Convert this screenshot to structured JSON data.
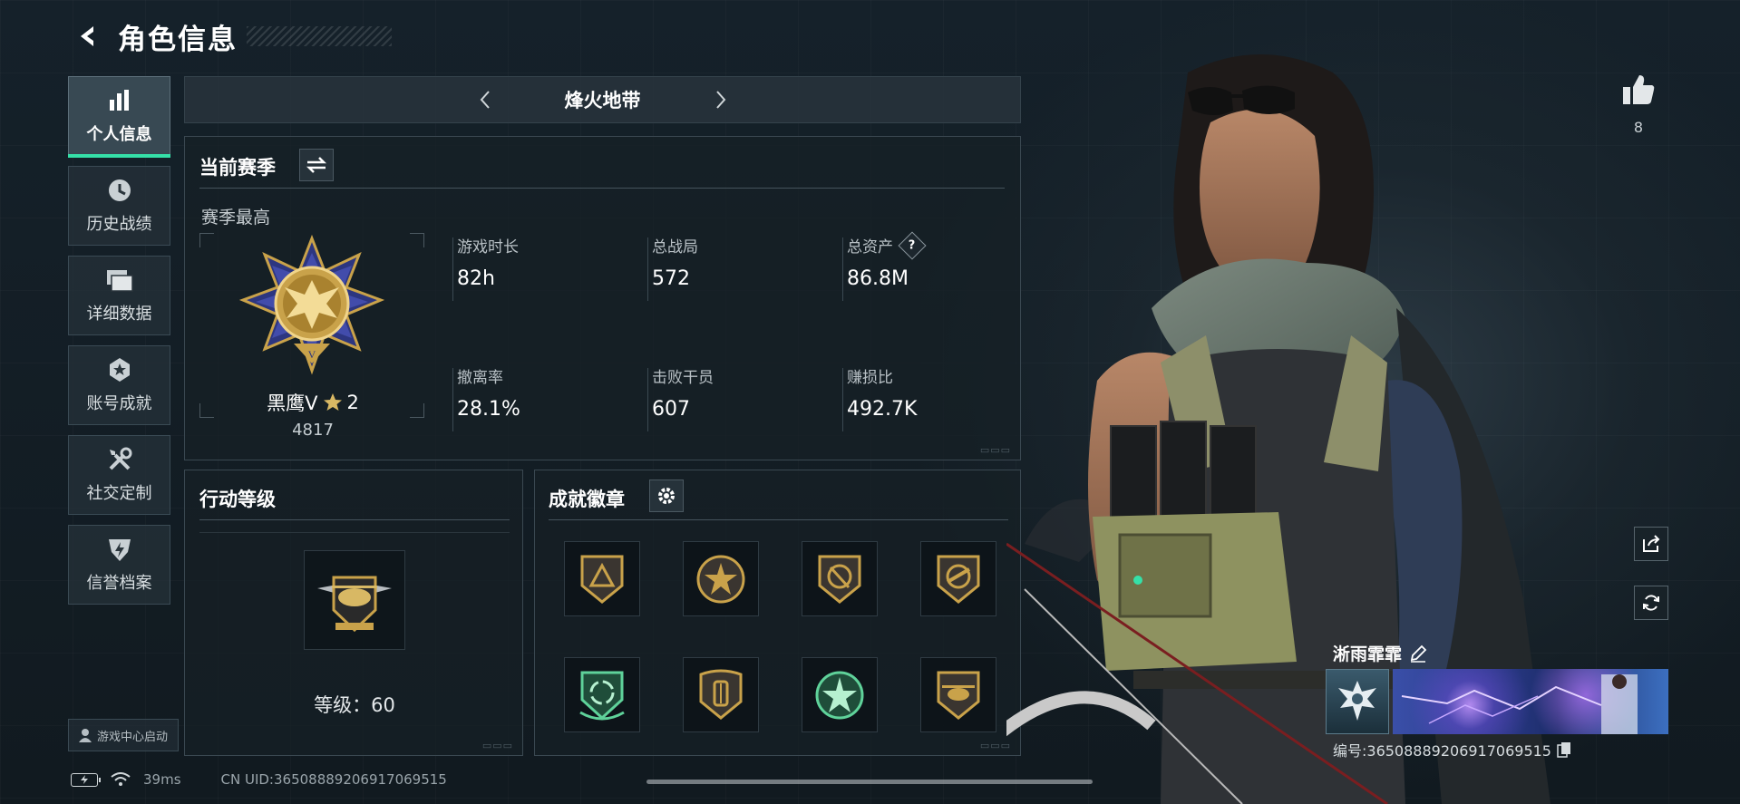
{
  "header": {
    "title": "角色信息"
  },
  "sidebar": {
    "items": [
      {
        "label": "个人信息",
        "icon": "bar-chart-icon",
        "active": true
      },
      {
        "label": "历史战绩",
        "icon": "clock-icon",
        "active": false
      },
      {
        "label": "详细数据",
        "icon": "folder-icon",
        "active": false
      },
      {
        "label": "账号成就",
        "icon": "achievement-icon",
        "active": false
      },
      {
        "label": "社交定制",
        "icon": "tools-icon",
        "active": false
      },
      {
        "label": "信誉档案",
        "icon": "shield-bolt-icon",
        "active": false
      }
    ],
    "launch_label": "游戏中心启动"
  },
  "mode": {
    "name": "烽火地带"
  },
  "season": {
    "title": "当前赛季",
    "best_label": "赛季最高",
    "rank_name": "黑鹰V",
    "rank_stars": "2",
    "rank_score": "4817",
    "stats": [
      {
        "label": "游戏时长",
        "value": "82h"
      },
      {
        "label": "总战局",
        "value": "572"
      },
      {
        "label": "总资产",
        "value": "86.8M",
        "help": "?"
      },
      {
        "label": "撤离率",
        "value": "28.1%"
      },
      {
        "label": "击败干员",
        "value": "607"
      },
      {
        "label": "赚损比",
        "value": "492.7K"
      }
    ]
  },
  "action_level": {
    "title": "行动等级",
    "level_text": "等级：60"
  },
  "badges": {
    "title": "成就徽章",
    "items": [
      {
        "icon": "triangle-shield-badge-icon"
      },
      {
        "icon": "star-round-badge-icon"
      },
      {
        "icon": "slash-shield-badge-icon"
      },
      {
        "icon": "rifle-shield-badge-icon"
      },
      {
        "icon": "recycle-green-badge-icon"
      },
      {
        "icon": "knife-shield-badge-icon"
      },
      {
        "icon": "star-green-badge-icon"
      },
      {
        "icon": "helicopter-badge-icon"
      }
    ]
  },
  "profile": {
    "likes": "8",
    "player_name": "淅雨霏霏",
    "player_uid": "编号:3650888920691706951​5"
  },
  "status": {
    "ping": "39ms",
    "uid": "CN UID:3650888920691706951​5"
  },
  "colors": {
    "accent": "#35e0a8",
    "gold": "#c9a24a",
    "panel_border": "#3a4851"
  }
}
